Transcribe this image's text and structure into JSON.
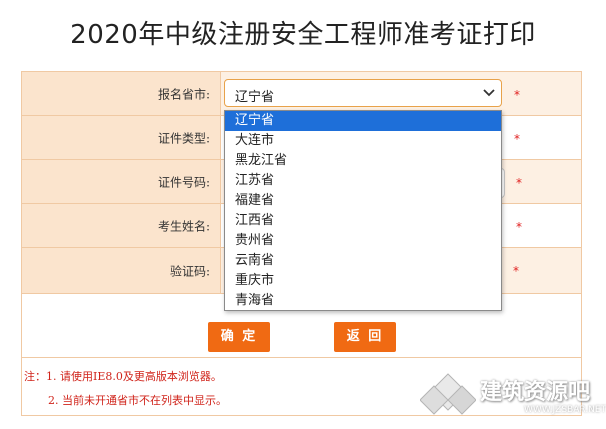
{
  "header": {
    "title": "2020年中级注册安全工程师准考证打印"
  },
  "form": {
    "rows": [
      {
        "label": "报名省市:",
        "required": "*"
      },
      {
        "label": "证件类型:",
        "required": "*"
      },
      {
        "label": "证件号码:",
        "required": "*"
      },
      {
        "label": "考生姓名:",
        "required": "*"
      },
      {
        "label": "验证码:",
        "required": "*"
      }
    ],
    "province_select": {
      "selected": "辽宁省",
      "options": [
        "辽宁省",
        "大连市",
        "黑龙江省",
        "江苏省",
        "福建省",
        "江西省",
        "贵州省",
        "云南省",
        "重庆市",
        "青海省"
      ]
    }
  },
  "actions": {
    "confirm_label": "确 定",
    "back_label": "返 回"
  },
  "notes": {
    "line1": "注：1. 请使用IE8.0及更高版本浏览器。",
    "line2": "2. 当前未开通省市不在列表中显示。"
  },
  "watermark": {
    "text": "建筑资源吧",
    "url": "WWW.JZSBAR.NET"
  },
  "colors": {
    "accent": "#f06a13",
    "label_bg": "#fbe4cd",
    "selected_option": "#1e6fd9",
    "required": "#e02020"
  }
}
